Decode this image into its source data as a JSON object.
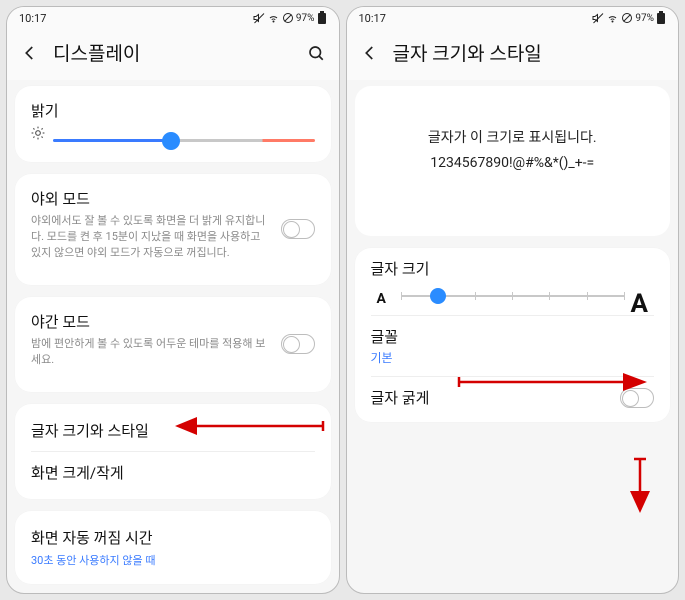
{
  "status": {
    "time": "10:17",
    "battery": "97%"
  },
  "left": {
    "title": "디스플레이",
    "brightness_label": "밝기",
    "brightness_pct": 45,
    "outdoor": {
      "title": "야외 모드",
      "desc": "야외에서도 잘 볼 수 있도록 화면을 더 밝게 유지합니다. 모드를 켠 후 15분이 지났을 때 화면을 사용하고 있지 않으면 야외 모드가 자동으로 꺼집니다."
    },
    "night": {
      "title": "야간 모드",
      "desc": "밤에 편안하게 볼 수 있도록 어두운 테마를 적용해 보세요."
    },
    "font_style": "글자 크기와 스타일",
    "screen_zoom": "화면 크게/작게",
    "timeout_title": "화면 자동 꺼짐 시간",
    "timeout_value": "30초 동안 사용하지 않을 때"
  },
  "right": {
    "title": "글자 크기와 스타일",
    "preview_line1": "글자가 이 크기로 표시됩니다.",
    "preview_line2": "1234567890!@#%&*()_+-=",
    "fontsize_label": "글자 크기",
    "fontsize_step": 2,
    "font_label": "글꼴",
    "font_value": "기본",
    "bold_label": "글자 굵게"
  }
}
